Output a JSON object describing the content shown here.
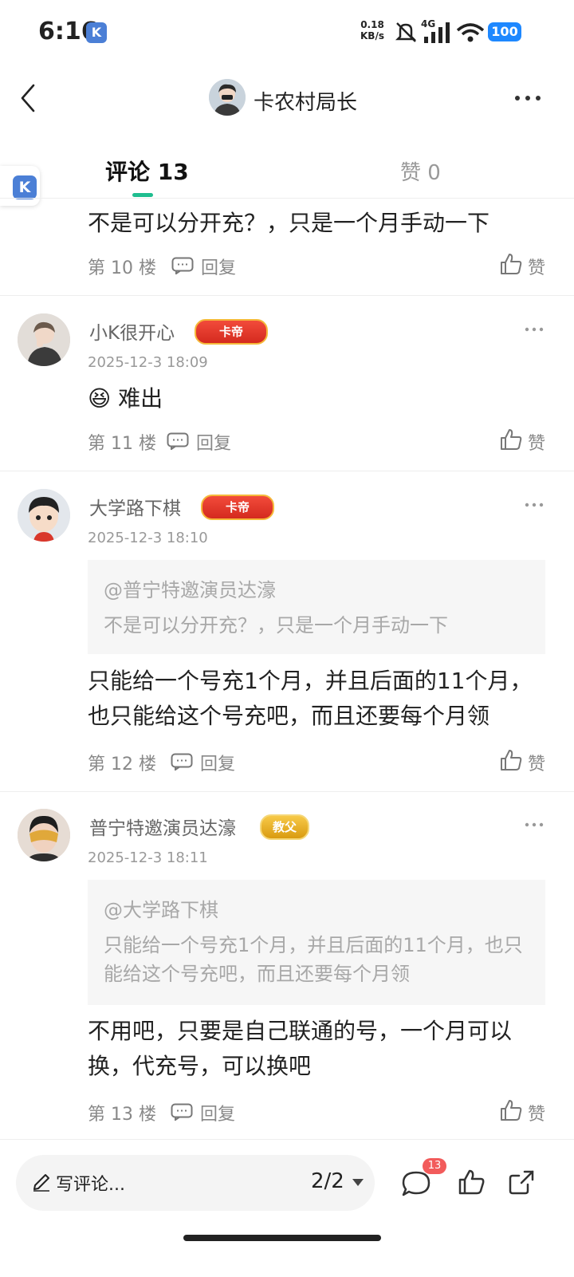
{
  "status_bar": {
    "time": "6:16",
    "app_badge": "K",
    "net_speed_value": "0.18",
    "net_speed_unit": "KB/s",
    "network": "4G",
    "battery": "100"
  },
  "header": {
    "title": "卡农村局长"
  },
  "tabs": {
    "comments": "评论 13",
    "likes": "赞 0"
  },
  "float_app": "K",
  "comments": [
    {
      "body": "不是可以分开充？，只是一个月手动一下",
      "floor": "第 10 楼",
      "reply": "回复",
      "like": "赞"
    },
    {
      "name": "小K很开心",
      "badge": "卡帝",
      "date": "2025-12-3 18:09",
      "emoji": "😆",
      "body": "难出",
      "floor": "第 11 楼",
      "reply": "回复",
      "like": "赞"
    },
    {
      "name": "大学路下棋",
      "badge": "卡帝",
      "date": "2025-12-3 18:10",
      "quote_user": "@普宁特邀演员达濠",
      "quote_text": "不是可以分开充？，只是一个月手动一下",
      "body": "只能给一个号充1个月，并且后面的11个月，也只能给这个号充吧，而且还要每个月领",
      "floor": "第 12 楼",
      "reply": "回复",
      "like": "赞"
    },
    {
      "name": "普宁特邀演员达濠",
      "badge": "教父",
      "date": "2025-12-3 18:11",
      "quote_user": "@大学路下棋",
      "quote_text": "只能给一个号充1个月，并且后面的11个月，也只能给这个号充吧，而且还要每个月领",
      "body": "不用吧，只要是自己联通的号，一个月可以换，代充号，可以换吧",
      "floor": "第 13 楼",
      "reply": "回复",
      "like": "赞"
    }
  ],
  "bottom_bar": {
    "write_placeholder": "写评论...",
    "page_indicator": "2/2",
    "comment_count": "13"
  },
  "colors": {
    "accent": "#1fbd8f",
    "badge_red": "#d42a1f",
    "badge_gold": "#d99b10",
    "count_badge": "#f25b5b"
  },
  "icons": [
    "back-icon",
    "more-icon",
    "reply-icon",
    "like-icon",
    "pencil-icon",
    "dropdown-icon",
    "comment-icon",
    "thumb-icon",
    "share-icon",
    "mute-icon",
    "signal-icon",
    "wifi-icon"
  ]
}
